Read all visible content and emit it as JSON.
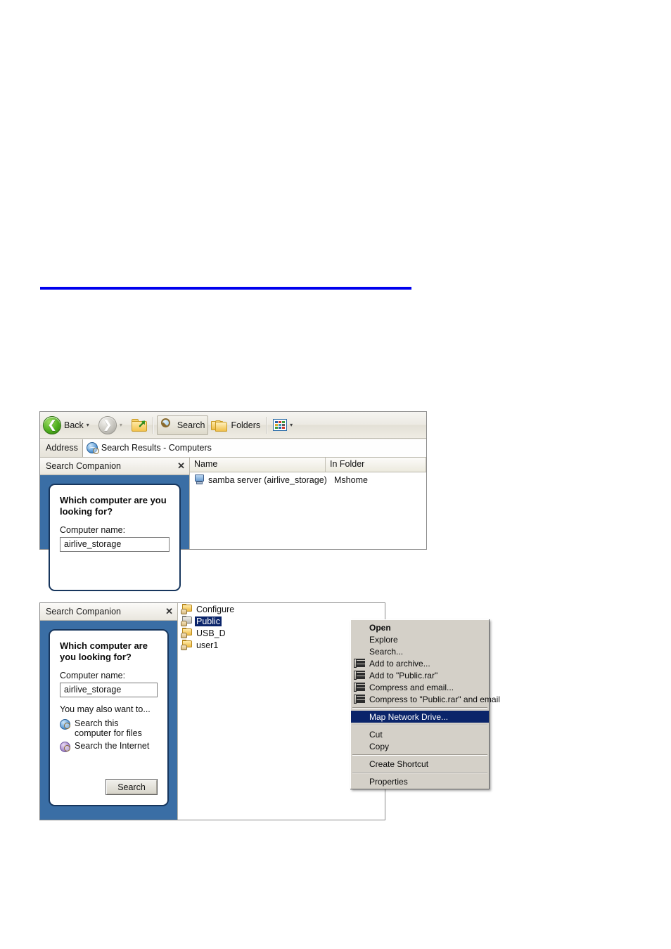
{
  "rule": {
    "present": true,
    "color": "#0000ee"
  },
  "figure1": {
    "toolbar": {
      "back_label": "Back",
      "back_icon": "back-arrow-icon",
      "back_caret": "▾",
      "forward_icon": "forward-arrow-icon",
      "forward_caret": "▾",
      "up_icon": "up-one-level-icon",
      "search_label": "Search",
      "search_icon": "magnifier-icon",
      "folders_label": "Folders",
      "folders_icon": "folders-icon",
      "views_icon": "views-icon",
      "views_caret": "▾"
    },
    "address": {
      "label": "Address",
      "icon": "search-results-globe-icon",
      "value": "Search Results - Computers"
    },
    "search_companion": {
      "title": "Search Companion",
      "close_label": "✕",
      "question": "Which computer are you looking for?",
      "name_label": "Computer name:",
      "name_value": "airlive_storage"
    },
    "results": {
      "columns": [
        "Name",
        "In Folder"
      ],
      "rows": [
        {
          "icon": "computer-icon",
          "name": "samba server (airlive_storage)",
          "in_folder": "Mshome"
        }
      ]
    }
  },
  "figure2": {
    "search_companion": {
      "title": "Search Companion",
      "close_label": "✕",
      "question": "Which computer are you looking for?",
      "name_label": "Computer name:",
      "name_value": "airlive_storage",
      "also_label": "You may also want to...",
      "links": [
        {
          "icon": "search-computer-icon",
          "label": "Search this computer for files"
        },
        {
          "icon": "search-internet-icon",
          "label": "Search the Internet"
        }
      ],
      "search_button": "Search"
    },
    "shares": [
      {
        "icon": "share-folder-icon",
        "label": "Configure",
        "selected": false
      },
      {
        "icon": "share-folder-grey-icon",
        "label": "Public",
        "selected": true
      },
      {
        "icon": "share-folder-icon",
        "label": "USB_D",
        "selected": false
      },
      {
        "icon": "share-folder-icon",
        "label": "user1",
        "selected": false
      }
    ],
    "context_menu": {
      "items": [
        {
          "label": "Open",
          "bold": true,
          "icon": null,
          "highlighted": false,
          "separator_before": false
        },
        {
          "label": "Explore",
          "bold": false,
          "icon": null,
          "highlighted": false,
          "separator_before": false
        },
        {
          "label": "Search...",
          "bold": false,
          "icon": null,
          "highlighted": false,
          "separator_before": false
        },
        {
          "label": "Add to archive...",
          "bold": false,
          "icon": "winrar-icon",
          "highlighted": false,
          "separator_before": false
        },
        {
          "label": "Add to \"Public.rar\"",
          "bold": false,
          "icon": "winrar-icon",
          "highlighted": false,
          "separator_before": false
        },
        {
          "label": "Compress and email...",
          "bold": false,
          "icon": "winrar-icon",
          "highlighted": false,
          "separator_before": false
        },
        {
          "label": "Compress to \"Public.rar\" and email",
          "bold": false,
          "icon": "winrar-icon",
          "highlighted": false,
          "separator_before": false
        },
        {
          "label": "Map Network Drive...",
          "bold": false,
          "icon": null,
          "highlighted": true,
          "separator_before": true
        },
        {
          "label": "Cut",
          "bold": false,
          "icon": null,
          "highlighted": false,
          "separator_before": true
        },
        {
          "label": "Copy",
          "bold": false,
          "icon": null,
          "highlighted": false,
          "separator_before": false
        },
        {
          "label": "Create Shortcut",
          "bold": false,
          "icon": null,
          "highlighted": false,
          "separator_before": true
        },
        {
          "label": "Properties",
          "bold": false,
          "icon": null,
          "highlighted": false,
          "separator_before": true
        }
      ]
    }
  }
}
